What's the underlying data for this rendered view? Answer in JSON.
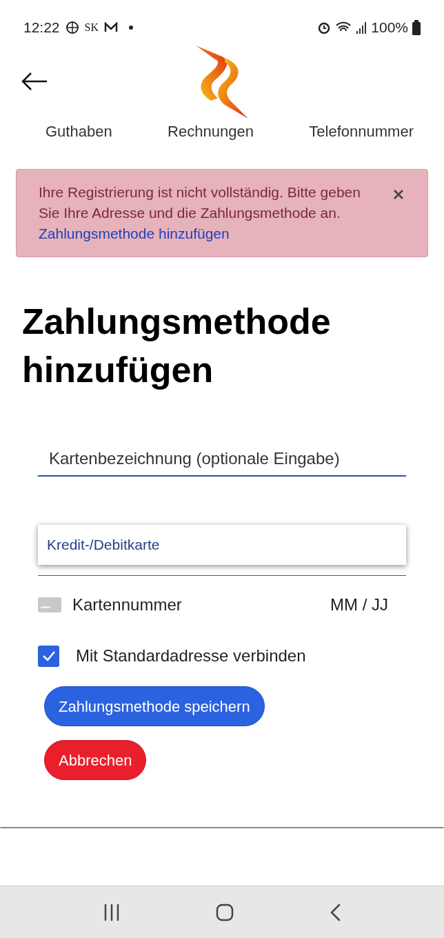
{
  "status_bar": {
    "time": "12:22",
    "carrier": "SK",
    "battery": "100%"
  },
  "nav_tabs": [
    {
      "label": "Guthaben"
    },
    {
      "label": "Rechnungen"
    },
    {
      "label": "Telefonnummer"
    }
  ],
  "alert": {
    "message": "Ihre Registrierung ist nicht vollständig. Bitte geben Sie Ihre Adresse und die Zahlungsmethode an.",
    "link": "Zahlungsmethode hinzufügen"
  },
  "title": "Zahlungsmethode hinzufügen",
  "card_label_field": {
    "placeholder": "Kartenbezeichnung (optionale Eingabe)"
  },
  "payment_type": {
    "options": [
      "Kredit-/Debitkarte"
    ]
  },
  "card_field": {
    "number_placeholder": "Kartennummer",
    "expiry_placeholder": "MM / JJ"
  },
  "default_address": {
    "label": "Mit Standardadresse verbinden",
    "checked": true
  },
  "buttons": [
    {
      "label": "Zahlungsmethode speichern",
      "kind": "primary"
    },
    {
      "label": "Abbrechen",
      "kind": "danger"
    }
  ]
}
